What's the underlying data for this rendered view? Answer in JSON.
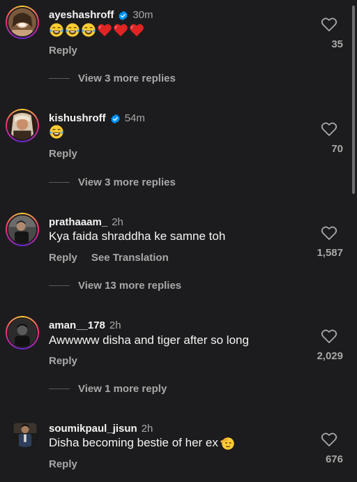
{
  "colors": {
    "background": "#1c1c1e",
    "text_primary": "#f5f5f5",
    "text_secondary": "#a8a8a8",
    "verified_blue": "#0095f6",
    "heart_red": "#e02424"
  },
  "comments": [
    {
      "username": "ayeshashroff",
      "verified": true,
      "time": "30m",
      "body_text": "",
      "emojis": [
        "tears-of-joy",
        "tears-of-joy",
        "tears-of-joy",
        "red-heart",
        "red-heart",
        "red-heart"
      ],
      "reply_label": "Reply",
      "likes": "35",
      "view_more": "View 3 more replies"
    },
    {
      "username": "kishushroff",
      "verified": true,
      "time": "54m",
      "body_text": "",
      "emojis": [
        "tears-of-joy"
      ],
      "reply_label": "Reply",
      "likes": "70",
      "view_more": "View 3 more replies"
    },
    {
      "username": "prathaaam_",
      "verified": false,
      "time": "2h",
      "body_text": "Kya faida shraddha ke samne toh",
      "emojis": [],
      "reply_label": "Reply",
      "translation_label": "See Translation",
      "likes": "1,587",
      "view_more": "View 13 more replies"
    },
    {
      "username": "aman__178",
      "verified": false,
      "time": "2h",
      "body_text": "Awwwww disha and tiger after so long",
      "emojis": [],
      "reply_label": "Reply",
      "likes": "2,029",
      "view_more": "View 1 more reply"
    },
    {
      "username": "soumikpaul_jisun",
      "verified": false,
      "time": "2h",
      "body_text": "Disha becoming bestie of her ex",
      "emojis": [
        "saluting-face"
      ],
      "reply_label": "Reply",
      "likes": "676",
      "view_more": ""
    }
  ]
}
